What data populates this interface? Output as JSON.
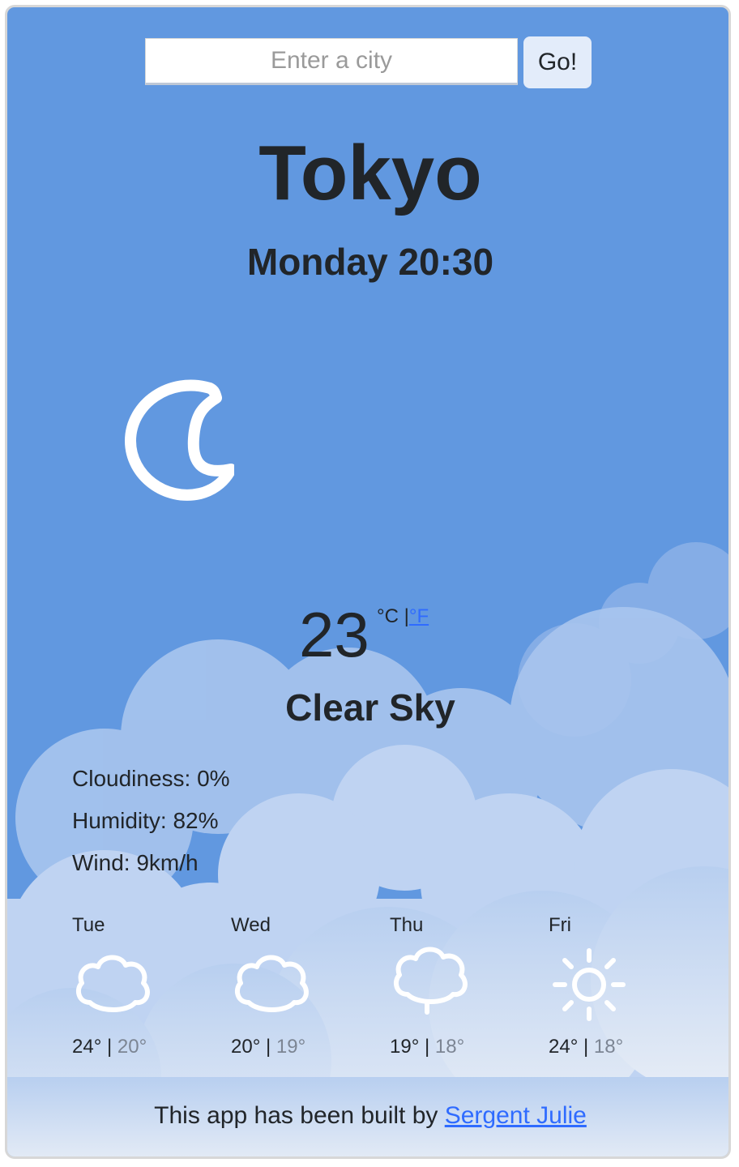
{
  "search": {
    "placeholder": "Enter a city",
    "value": "",
    "button_label": "Go!"
  },
  "city": "Tokyo",
  "datetime": "Monday 20:30",
  "current": {
    "icon": "moon-icon",
    "temperature": "23",
    "unit_celsius": "°C",
    "unit_separator": "|",
    "unit_fahrenheit": "°F",
    "description": "Clear Sky",
    "cloudiness": "Cloudiness: 0%",
    "humidity": "Humidity: 82%",
    "wind": "Wind: 9km/h"
  },
  "forecast": [
    {
      "day": "Tue",
      "icon": "cloud-icon",
      "high": "24°",
      "separator": "|",
      "low": "20°"
    },
    {
      "day": "Wed",
      "icon": "cloud-icon",
      "high": "20°",
      "separator": "|",
      "low": "19°"
    },
    {
      "day": "Thu",
      "icon": "rain-cloud-icon",
      "high": "19°",
      "separator": "|",
      "low": "18°"
    },
    {
      "day": "Fri",
      "icon": "sun-icon",
      "high": "24°",
      "separator": "|",
      "low": "18°"
    }
  ],
  "footer": {
    "text": "This app has been built by",
    "author_link": "Sergent Julie"
  },
  "colors": {
    "sky": "#6198e0",
    "text": "#212529",
    "link": "#2f6bff",
    "muted": "#7c8593"
  }
}
